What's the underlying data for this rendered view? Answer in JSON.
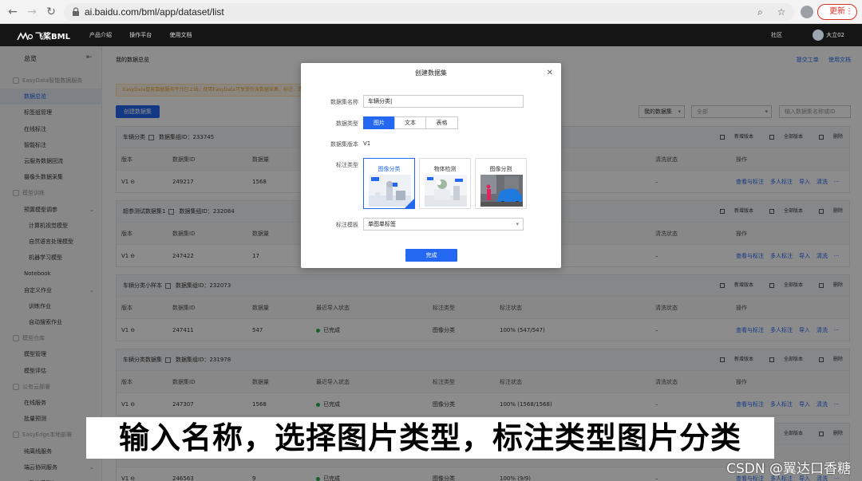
{
  "browser": {
    "url": "ai.baidu.com/bml/app/dataset/list",
    "update_label": "更新"
  },
  "app": {
    "logo": "飞桨BML",
    "nav": [
      "产品介绍",
      "操作平台",
      "使用文档"
    ],
    "community": "社区",
    "user": "大立02"
  },
  "sidebar": {
    "title": "总览",
    "items": [
      {
        "label": "EasyData智能数据服务",
        "kind": "group"
      },
      {
        "label": "数据总览",
        "kind": "item",
        "active": true
      },
      {
        "label": "标签组管理",
        "kind": "item"
      },
      {
        "label": "在线标注",
        "kind": "item"
      },
      {
        "label": "智能标注",
        "kind": "item"
      },
      {
        "label": "云服务数据回流",
        "kind": "item"
      },
      {
        "label": "摄像头数据采集",
        "kind": "item"
      },
      {
        "label": "模型训练",
        "kind": "group"
      },
      {
        "label": "预置模型调参",
        "kind": "item",
        "expandable": true
      },
      {
        "label": "计算机视觉模型",
        "kind": "sub"
      },
      {
        "label": "自然语言处理模型",
        "kind": "sub"
      },
      {
        "label": "机器学习模型",
        "kind": "sub"
      },
      {
        "label": "Notebook",
        "kind": "item"
      },
      {
        "label": "自定义作业",
        "kind": "item",
        "expandable": true
      },
      {
        "label": "训练作业",
        "kind": "sub"
      },
      {
        "label": "自动搜索作业",
        "kind": "sub"
      },
      {
        "label": "模型仓库",
        "kind": "group"
      },
      {
        "label": "模型管理",
        "kind": "item"
      },
      {
        "label": "模型评估",
        "kind": "item"
      },
      {
        "label": "公有云部署",
        "kind": "group"
      },
      {
        "label": "在线服务",
        "kind": "item"
      },
      {
        "label": "批量预测",
        "kind": "item"
      },
      {
        "label": "EasyEdge本地部署",
        "kind": "group"
      },
      {
        "label": "纯离线服务",
        "kind": "item"
      },
      {
        "label": "端云协同服务",
        "kind": "item",
        "expandable": true
      },
      {
        "label": "我的模型包",
        "kind": "sub"
      }
    ]
  },
  "main": {
    "breadcrumb": "我的数据总览",
    "links": [
      "提交工单",
      "使用文档"
    ],
    "banner": "EasyData智能数据服务平台已上线，使用EasyData可享受包含数据采集、标注、清洗…",
    "create_button": "创建数据集",
    "filter_mine": "我的数据集",
    "filter_all": "全部",
    "search_placeholder": "输入数据集名称或ID",
    "columns": [
      "版本",
      "数据集ID",
      "数据量",
      "最近导入状态",
      "标注类型",
      "标注状态",
      "清洗状态",
      "操作"
    ],
    "group_actions": [
      "新增版本",
      "全部版本",
      "删除"
    ],
    "row_actions": [
      "查看与标注",
      "多人标注",
      "导入",
      "清洗",
      "···"
    ],
    "groups": [
      {
        "name": "车辆分类",
        "group_id": "数据集组ID：233745",
        "version": "V1",
        "dataset_id": "249217",
        "count": "1568",
        "import_status": "",
        "label_type": "",
        "label_status": "",
        "clean_status": "–"
      },
      {
        "name": "超参测试数据集1",
        "group_id": "数据集组ID：232084",
        "version": "V1",
        "dataset_id": "247422",
        "count": "17",
        "import_status": "",
        "label_type": "",
        "label_status": "",
        "clean_status": "–"
      },
      {
        "name": "车辆分类小样本",
        "group_id": "数据集组ID：232073",
        "version": "V1",
        "dataset_id": "247411",
        "count": "547",
        "import_status": "已完成",
        "label_type": "图像分类",
        "label_status": "100% (547/547)",
        "clean_status": "–"
      },
      {
        "name": "车辆分类数据集",
        "group_id": "数据集组ID：231978",
        "version": "V1",
        "dataset_id": "247307",
        "count": "1568",
        "import_status": "已完成",
        "label_type": "图像分类",
        "label_status": "100% (1568/1568)",
        "clean_status": "–"
      },
      {
        "name": "",
        "group_id": "",
        "version": "V1",
        "dataset_id": "246563",
        "count": "9",
        "import_status": "已完成",
        "label_type": "图像分类",
        "label_status": "100% (9/9)",
        "clean_status": "–"
      }
    ]
  },
  "modal": {
    "title": "创建数据集",
    "name_label": "数据集名称",
    "name_value": "车辆分类",
    "type_label": "数据类型",
    "types": [
      "图片",
      "文本",
      "表格"
    ],
    "version_label": "数据集版本",
    "version_value": "V1",
    "label_type_label": "标注类型",
    "label_types": [
      "图像分类",
      "物体检测",
      "图像分割"
    ],
    "template_label": "标注模板",
    "template_value": "单图单标签",
    "done_button": "完成"
  },
  "subtitle": "输入名称，选择图片类型，标注类型图片分类",
  "watermark": "CSDN @翼达口香糖",
  "colors": {
    "primary": "#2468f2",
    "header_bg": "#151515",
    "success": "#27b346"
  }
}
